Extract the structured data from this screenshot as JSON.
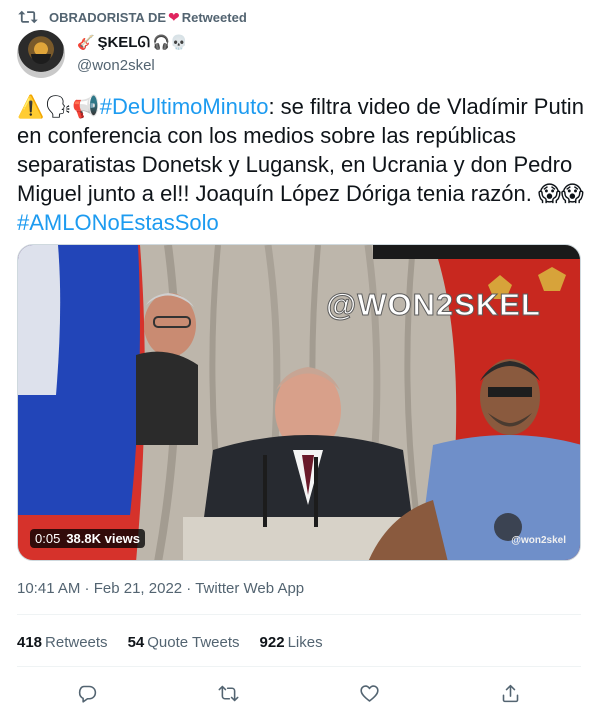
{
  "retweet_header": {
    "who": "OBRADORISTA DE",
    "action": "Retweeted"
  },
  "author": {
    "display_name": "ŞKELᘏ",
    "handle": "@won2skel",
    "name_emoji_before": "🎸",
    "name_emoji_after": "🎧💀"
  },
  "tweet": {
    "emojis_lead": "⚠️🗣📢",
    "hashtag1": "#DeUltimoMinuto",
    "text_part1": ":  se filtra video de Vladímir Putin en conferencia con los medios sobre  las repúblicas separatistas Donetsk y Lugansk, en Ucrania y don Pedro Miguel junto a el!!  Joaquín López Dóriga tenia razón. ",
    "emojis_tail": "😱😱",
    "hashtag2": "#AMLONoEstasSolo"
  },
  "media": {
    "watermark": "@WON2SKEL",
    "corner_watermark": "@won2skel",
    "time": "0:05",
    "views": "38.8K views"
  },
  "meta": {
    "time": "10:41 AM",
    "date": "Feb 21, 2022",
    "source": "Twitter Web App",
    "sep": " · "
  },
  "stats": {
    "retweets_count": "418",
    "retweets_label": "Retweets",
    "quotes_count": "54",
    "quotes_label": "Quote Tweets",
    "likes_count": "922",
    "likes_label": "Likes"
  },
  "colors": {
    "link": "#1d9bf0",
    "muted": "#536471",
    "text": "#0f1419",
    "heart": "#e0245e"
  },
  "icons": [
    "retweet-icon",
    "reply-icon",
    "like-icon",
    "share-icon"
  ]
}
